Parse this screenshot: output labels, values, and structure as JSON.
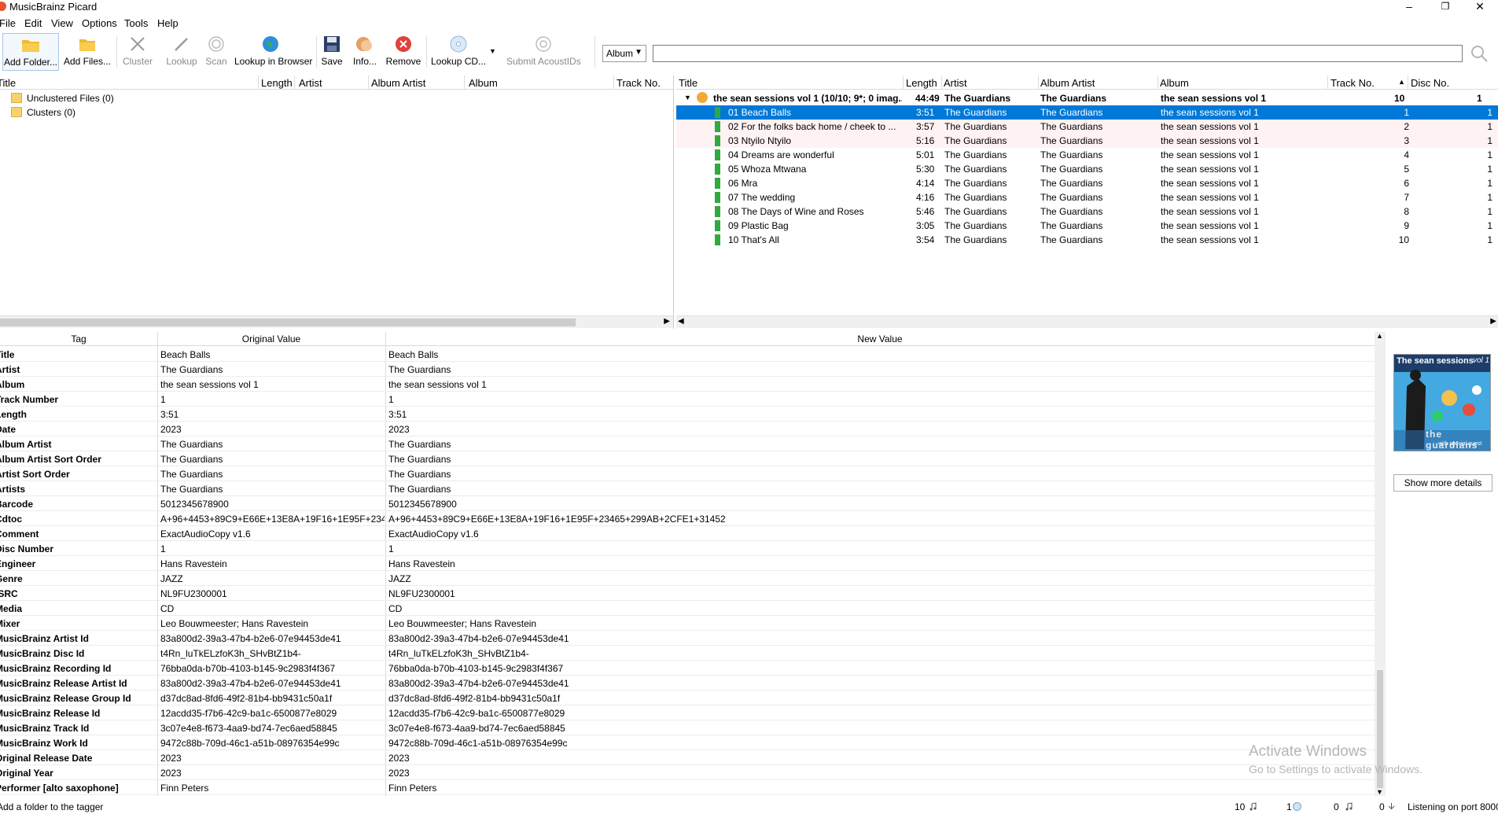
{
  "window": {
    "title": "MusicBrainz Picard",
    "minimize": "–",
    "restore": "❐",
    "close": "✕"
  },
  "menu": [
    "File",
    "Edit",
    "View",
    "Options",
    "Tools",
    "Help"
  ],
  "toolbar": {
    "add_folder": "Add Folder...",
    "add_files": "Add Files...",
    "cluster": "Cluster",
    "lookup": "Lookup",
    "scan": "Scan",
    "lookup_browser": "Lookup in Browser",
    "save": "Save",
    "info": "Info...",
    "remove": "Remove",
    "lookup_cd": "Lookup CD...",
    "submit_acoustids": "Submit AcoustIDs",
    "mode_select": "Album",
    "search_placeholder": ""
  },
  "left_pane": {
    "headers": [
      "Title",
      "Length",
      "Artist",
      "Album Artist",
      "Album",
      "Track No."
    ],
    "items": [
      "Unclustered Files (0)",
      "Clusters (0)"
    ]
  },
  "right_pane": {
    "headers": [
      "Title",
      "Length",
      "Artist",
      "Album Artist",
      "Album",
      "Track No.",
      "Disc No."
    ],
    "album": {
      "title": "the sean sessions vol 1 (10/10; 9*; 0 imag...",
      "length": "44:49",
      "artist": "The Guardians",
      "album_artist": "The Guardians",
      "album": "the sean sessions vol 1",
      "track": "10",
      "disc": "1"
    },
    "tracks": [
      {
        "title": "01  Beach Balls",
        "length": "3:51",
        "artist": "The Guardians",
        "album_artist": "The Guardians",
        "album": "the sean sessions vol 1",
        "track": "1",
        "disc": "1"
      },
      {
        "title": "02  For the folks back home / cheek to ...",
        "length": "3:57",
        "artist": "The Guardians",
        "album_artist": "The Guardians",
        "album": "the sean sessions vol 1",
        "track": "2",
        "disc": "1"
      },
      {
        "title": "03  Ntyilo Ntyilo",
        "length": "5:16",
        "artist": "The Guardians",
        "album_artist": "The Guardians",
        "album": "the sean sessions vol 1",
        "track": "3",
        "disc": "1"
      },
      {
        "title": "04  Dreams are wonderful",
        "length": "5:01",
        "artist": "The Guardians",
        "album_artist": "The Guardians",
        "album": "the sean sessions vol 1",
        "track": "4",
        "disc": "1"
      },
      {
        "title": "05  Whoza Mtwana",
        "length": "5:30",
        "artist": "The Guardians",
        "album_artist": "The Guardians",
        "album": "the sean sessions vol 1",
        "track": "5",
        "disc": "1"
      },
      {
        "title": "06  Mra",
        "length": "4:14",
        "artist": "The Guardians",
        "album_artist": "The Guardians",
        "album": "the sean sessions vol 1",
        "track": "6",
        "disc": "1"
      },
      {
        "title": "07  The wedding",
        "length": "4:16",
        "artist": "The Guardians",
        "album_artist": "The Guardians",
        "album": "the sean sessions vol 1",
        "track": "7",
        "disc": "1"
      },
      {
        "title": "08  The Days of Wine and Roses",
        "length": "5:46",
        "artist": "The Guardians",
        "album_artist": "The Guardians",
        "album": "the sean sessions vol 1",
        "track": "8",
        "disc": "1"
      },
      {
        "title": "09  Plastic Bag",
        "length": "3:05",
        "artist": "The Guardians",
        "album_artist": "The Guardians",
        "album": "the sean sessions vol 1",
        "track": "9",
        "disc": "1"
      },
      {
        "title": "10  That's All",
        "length": "3:54",
        "artist": "The Guardians",
        "album_artist": "The Guardians",
        "album": "the sean sessions vol 1",
        "track": "10",
        "disc": "1"
      }
    ]
  },
  "metadata": {
    "headers": [
      "Tag",
      "Original Value",
      "New Value"
    ],
    "rows": [
      {
        "tag": "Title",
        "orig": "Beach Balls",
        "new": "Beach Balls"
      },
      {
        "tag": "Artist",
        "orig": "The Guardians",
        "new": "The Guardians"
      },
      {
        "tag": "Album",
        "orig": "the sean sessions vol 1",
        "new": "the sean sessions vol 1"
      },
      {
        "tag": "Track Number",
        "orig": "1",
        "new": "1"
      },
      {
        "tag": "Length",
        "orig": "3:51",
        "new": "3:51"
      },
      {
        "tag": "Date",
        "orig": "2023",
        "new": "2023"
      },
      {
        "tag": "Album Artist",
        "orig": "The Guardians",
        "new": "The Guardians"
      },
      {
        "tag": "Album Artist Sort Order",
        "orig": "The Guardians",
        "new": "The Guardians"
      },
      {
        "tag": "Artist Sort Order",
        "orig": "The Guardians",
        "new": "The Guardians"
      },
      {
        "tag": "Artists",
        "orig": "The Guardians",
        "new": "The Guardians"
      },
      {
        "tag": "Barcode",
        "orig": "5012345678900",
        "new": "5012345678900"
      },
      {
        "tag": "Cdtoc",
        "orig": "A+96+4453+89C9+E66E+13E8A+19F16+1E95F+234...",
        "new": "A+96+4453+89C9+E66E+13E8A+19F16+1E95F+23465+299AB+2CFE1+31452"
      },
      {
        "tag": "Comment",
        "orig": "ExactAudioCopy v1.6",
        "new": "ExactAudioCopy v1.6"
      },
      {
        "tag": "Disc Number",
        "orig": "1",
        "new": "1"
      },
      {
        "tag": "Engineer",
        "orig": "Hans Ravestein",
        "new": "Hans Ravestein"
      },
      {
        "tag": "Genre",
        "orig": "JAZZ",
        "new": "JAZZ"
      },
      {
        "tag": "ISRC",
        "orig": "NL9FU2300001",
        "new": "NL9FU2300001"
      },
      {
        "tag": "Media",
        "orig": "CD",
        "new": "CD"
      },
      {
        "tag": "Mixer",
        "orig": "Leo Bouwmeester; Hans Ravestein",
        "new": "Leo Bouwmeester; Hans Ravestein"
      },
      {
        "tag": "MusicBrainz Artist Id",
        "orig": "83a800d2-39a3-47b4-b2e6-07e94453de41",
        "new": "83a800d2-39a3-47b4-b2e6-07e94453de41"
      },
      {
        "tag": "MusicBrainz Disc Id",
        "orig": "t4Rn_luTkELzfoK3h_SHvBtZ1b4-",
        "new": "t4Rn_luTkELzfoK3h_SHvBtZ1b4-"
      },
      {
        "tag": "MusicBrainz Recording Id",
        "orig": "76bba0da-b70b-4103-b145-9c2983f4f367",
        "new": "76bba0da-b70b-4103-b145-9c2983f4f367"
      },
      {
        "tag": "MusicBrainz Release Artist Id",
        "orig": "83a800d2-39a3-47b4-b2e6-07e94453de41",
        "new": "83a800d2-39a3-47b4-b2e6-07e94453de41"
      },
      {
        "tag": "MusicBrainz Release Group Id",
        "orig": "d37dc8ad-8fd6-49f2-81b4-bb9431c50a1f",
        "new": "d37dc8ad-8fd6-49f2-81b4-bb9431c50a1f"
      },
      {
        "tag": "MusicBrainz Release Id",
        "orig": "12acdd35-f7b6-42c9-ba1c-6500877e8029",
        "new": "12acdd35-f7b6-42c9-ba1c-6500877e8029"
      },
      {
        "tag": "MusicBrainz Track Id",
        "orig": "3c07e4e8-f673-4aa9-bd74-7ec6aed58845",
        "new": "3c07e4e8-f673-4aa9-bd74-7ec6aed58845"
      },
      {
        "tag": "MusicBrainz Work Id",
        "orig": "9472c88b-709d-46c1-a51b-08976354e99c",
        "new": "9472c88b-709d-46c1-a51b-08976354e99c"
      },
      {
        "tag": "Original Release Date",
        "orig": "2023",
        "new": "2023"
      },
      {
        "tag": "Original Year",
        "orig": "2023",
        "new": "2023"
      },
      {
        "tag": "Performer [alto saxophone]",
        "orig": "Finn Peters",
        "new": "Finn Peters"
      }
    ]
  },
  "cover": {
    "title": "The sean sessions",
    "vol": "vol 1",
    "band": "the guardians",
    "subtitle": "with special guest"
  },
  "show_more": "Show more details",
  "watermark": {
    "line1": "Activate Windows",
    "line2": "Go to Settings to activate Windows."
  },
  "status": {
    "message": "Add a folder to the tagger",
    "files": "10",
    "pending": "1",
    "errors": "0",
    "queue": "0",
    "port": "Listening on port 8000"
  },
  "colors": {
    "selection": "#0078d7",
    "track_ok": "#2faa3f",
    "pending_row": "#fff2f2"
  }
}
